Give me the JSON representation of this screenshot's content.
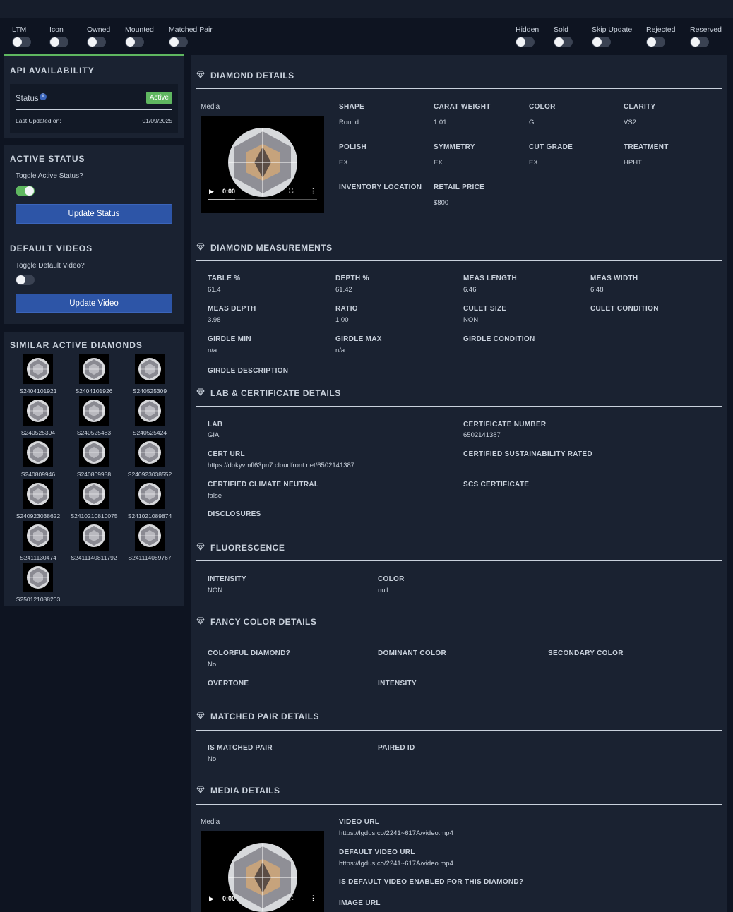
{
  "top_toggles_left": [
    {
      "label": "LTM",
      "on": false
    },
    {
      "label": "Icon",
      "on": false
    },
    {
      "label": "Owned",
      "on": false
    },
    {
      "label": "Mounted",
      "on": false
    },
    {
      "label": "Matched Pair",
      "on": false
    }
  ],
  "top_toggles_right": [
    {
      "label": "Hidden",
      "on": false
    },
    {
      "label": "Sold",
      "on": false
    },
    {
      "label": "Skip Update",
      "on": false
    },
    {
      "label": "Rejected",
      "on": false
    },
    {
      "label": "Reserved",
      "on": false
    }
  ],
  "api": {
    "title": "API AVAILABILITY",
    "status_label": "Status",
    "status_value": "Active",
    "status_color": "#5fb760",
    "last_updated_label": "Last Updated on:",
    "last_updated_value": "01/09/2025"
  },
  "active_status": {
    "title": "ACTIVE STATUS",
    "toggle_label": "Toggle Active Status?",
    "toggle_on": true,
    "button": "Update Status"
  },
  "default_videos": {
    "title": "DEFAULT VIDEOS",
    "toggle_label": "Toggle Default Video?",
    "toggle_on": false,
    "button": "Update Video"
  },
  "similar": {
    "title": "SIMILAR ACTIVE DIAMONDS",
    "items": [
      "S2404101921",
      "S2404101926",
      "S240525309",
      "S240525394",
      "S240525483",
      "S240525424",
      "S240809946",
      "S240809958",
      "S240923038552",
      "S240923038622",
      "S2410210810075",
      "S241021089874",
      "S2411130474",
      "S2411140811792",
      "S241114089767",
      "S250121088203"
    ]
  },
  "details": {
    "title": "DIAMOND DETAILS",
    "media_label": "Media",
    "video_time": "0:00",
    "fields": [
      {
        "label": "SHAPE",
        "value": "Round"
      },
      {
        "label": "CARAT WEIGHT",
        "value": "1.01"
      },
      {
        "label": "COLOR",
        "value": "G"
      },
      {
        "label": "CLARITY",
        "value": "VS2"
      },
      {
        "label": "POLISH",
        "value": "EX"
      },
      {
        "label": "SYMMETRY",
        "value": "EX"
      },
      {
        "label": "CUT GRADE",
        "value": "EX"
      },
      {
        "label": "TREATMENT",
        "value": "HPHT"
      },
      {
        "label": "INVENTORY LOCATION",
        "value": ""
      },
      {
        "label": "RETAIL PRICE",
        "value": "$800"
      }
    ]
  },
  "measurements": {
    "title": "DIAMOND MEASUREMENTS",
    "fields": [
      {
        "label": "TABLE %",
        "value": "61.4"
      },
      {
        "label": "DEPTH %",
        "value": "61.42"
      },
      {
        "label": "MEAS LENGTH",
        "value": "6.46"
      },
      {
        "label": "MEAS WIDTH",
        "value": "6.48"
      },
      {
        "label": "MEAS DEPTH",
        "value": "3.98"
      },
      {
        "label": "RATIO",
        "value": "1.00"
      },
      {
        "label": "CULET SIZE",
        "value": "NON"
      },
      {
        "label": "CULET CONDITION",
        "value": ""
      },
      {
        "label": "GIRDLE MIN",
        "value": "n/a"
      },
      {
        "label": "GIRDLE MAX",
        "value": "n/a"
      },
      {
        "label": "GIRDLE CONDITION",
        "value": ""
      },
      {
        "label": "GIRDLE DESCRIPTION",
        "value": ""
      }
    ]
  },
  "lab": {
    "title": "LAB & CERTIFICATE DETAILS",
    "fields": [
      {
        "label": "LAB",
        "value": "GIA"
      },
      {
        "label": "CERTIFICATE NUMBER",
        "value": "6502141387"
      },
      {
        "label": "CERT URL",
        "value": "https://dokyvmfl63pn7.cloudfront.net/6502141387"
      },
      {
        "label": "CERTIFIED SUSTAINABILITY RATED",
        "value": ""
      },
      {
        "label": "CERTIFIED CLIMATE NEUTRAL",
        "value": "false"
      },
      {
        "label": "SCS CERTIFICATE",
        "value": ""
      },
      {
        "label": "DISCLOSURES",
        "value": ""
      }
    ]
  },
  "fluorescence": {
    "title": "FLUORESCENCE",
    "fields": [
      {
        "label": "INTENSITY",
        "value": "NON"
      },
      {
        "label": "COLOR",
        "value": "null"
      }
    ]
  },
  "fancy": {
    "title": "FANCY COLOR DETAILS",
    "fields": [
      {
        "label": "COLORFUL DIAMOND?",
        "value": "No"
      },
      {
        "label": "DOMINANT COLOR",
        "value": ""
      },
      {
        "label": "SECONDARY COLOR",
        "value": ""
      },
      {
        "label": "OVERTONE",
        "value": ""
      },
      {
        "label": "INTENSITY",
        "value": ""
      }
    ]
  },
  "matched": {
    "title": "MATCHED PAIR DETAILS",
    "fields": [
      {
        "label": "IS MATCHED PAIR",
        "value": "No"
      },
      {
        "label": "PAIRED ID",
        "value": ""
      }
    ]
  },
  "media": {
    "title": "MEDIA DETAILS",
    "media_label": "Media",
    "video_time": "0:00",
    "fields": [
      {
        "label": "VIDEO URL",
        "value": "https://lgdus.co/2241~617A/video.mp4"
      },
      {
        "label": "DEFAULT VIDEO URL",
        "value": "https://lgdus.co/2241~617A/video.mp4"
      },
      {
        "label": "IS DEFAULT VIDEO ENABLED FOR THIS DIAMOND?",
        "value": ""
      },
      {
        "label": "IMAGE URL",
        "value": ""
      }
    ]
  }
}
